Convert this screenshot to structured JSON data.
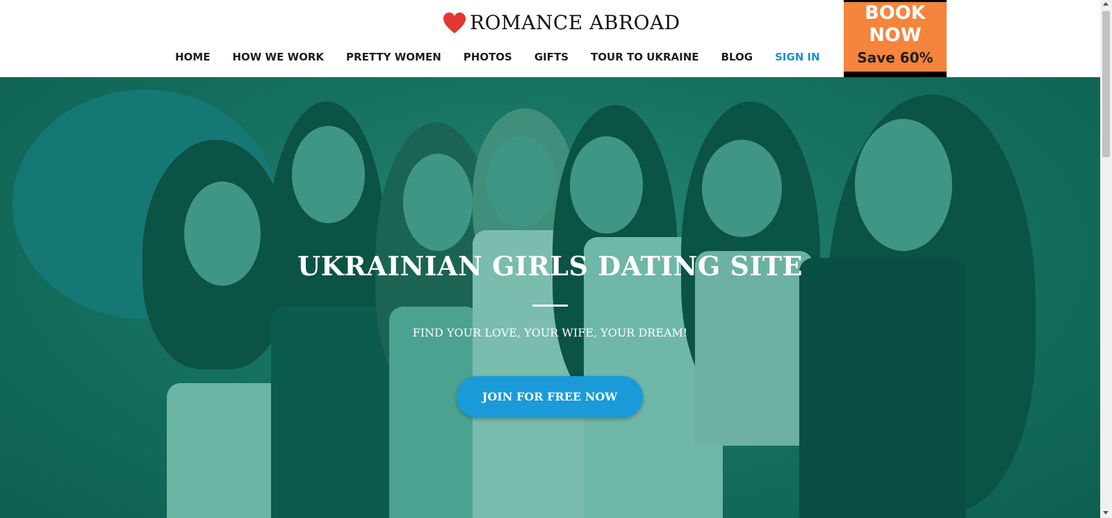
{
  "header": {
    "logo_text": "ROMANCE ABROAD",
    "logo_icon": "heart-icon",
    "nav": [
      {
        "label": "HOME"
      },
      {
        "label": "HOW WE WORK"
      },
      {
        "label": "PRETTY WOMEN"
      },
      {
        "label": "PHOTOS"
      },
      {
        "label": "GIFTS"
      },
      {
        "label": "TOUR TO UKRAINE"
      },
      {
        "label": "BLOG"
      },
      {
        "label": "SIGN IN"
      }
    ],
    "book": {
      "title_line1": "BOOK",
      "title_line2": "NOW",
      "save": "Save 60%"
    }
  },
  "hero": {
    "title": "UKRAINIAN GIRLS DATING SITE",
    "subtitle": "FIND YOUR LOVE, YOUR WIFE, YOUR DREAM!",
    "cta": "JOIN FOR FREE NOW"
  },
  "colors": {
    "accent": "#1a9ad8",
    "book_bg": "#f5843c",
    "heart": "#e2382f",
    "overlay": "#1f6f60"
  }
}
